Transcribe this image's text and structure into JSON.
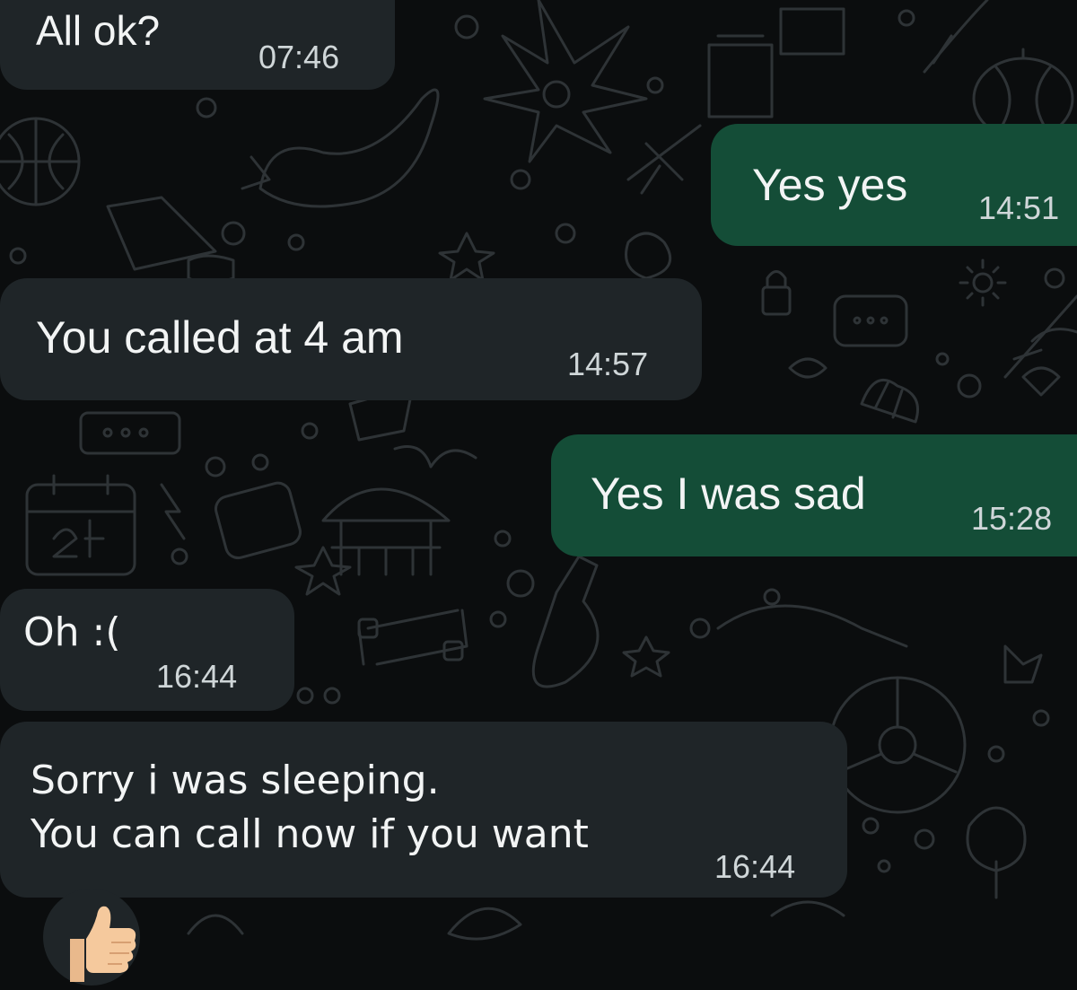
{
  "chat": {
    "messages": [
      {
        "direction": "incoming",
        "text": "All ok?",
        "time": "07:46"
      },
      {
        "direction": "outgoing",
        "text": "Yes yes",
        "time": "14:51"
      },
      {
        "direction": "incoming",
        "text": "You called at 4 am",
        "time": "14:57"
      },
      {
        "direction": "outgoing",
        "text": "Yes I was sad",
        "time": "15:28"
      },
      {
        "direction": "incoming",
        "text": "Oh :(",
        "time": "16:44"
      },
      {
        "direction": "incoming",
        "text": "Sorry i was sleeping.\nYou can call now if you want",
        "time": "16:44"
      }
    ],
    "reaction": {
      "icon": "thumbs-up-icon"
    }
  },
  "colors": {
    "background": "#0b0d0e",
    "incoming_bubble": "#1f2528",
    "outgoing_bubble": "#144d37",
    "text": "#f2f4f4",
    "timestamp": "#cfd6d8"
  }
}
